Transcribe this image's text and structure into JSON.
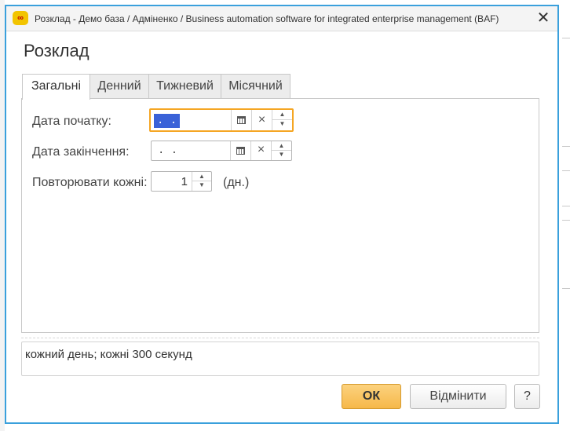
{
  "window": {
    "title": "Розклад - Демо база / Адміненко / Business automation software for integrated enterprise management  (BAF)",
    "close_glyph": "✕",
    "logo_text": "∞"
  },
  "form": {
    "title": "Розклад"
  },
  "tabs": [
    {
      "label": "Загальні",
      "active": true
    },
    {
      "label": "Денний",
      "active": false
    },
    {
      "label": "Тижневий",
      "active": false
    },
    {
      "label": "Місячний",
      "active": false
    }
  ],
  "fields": {
    "start_date": {
      "label": "Дата початку:",
      "value": " .  . ",
      "focused": true
    },
    "end_date": {
      "label": "Дата закінчення:",
      "value": " .  . "
    },
    "repeat": {
      "label": "Повторювати кожні:",
      "value": "1",
      "unit": "(дн.)"
    }
  },
  "icons": {
    "calendar": "calendar-icon",
    "clear": "×",
    "spin_up": "▲",
    "spin_down": "▼"
  },
  "summary": "кожний день; кожні 300 секунд",
  "buttons": {
    "ok": "ОК",
    "cancel": "Відмінити",
    "help": "?"
  },
  "colors": {
    "accent_border": "#3aa0dc",
    "focus": "#f5a623",
    "ok_button": "#f6b84a",
    "selection": "#3a62d8"
  }
}
